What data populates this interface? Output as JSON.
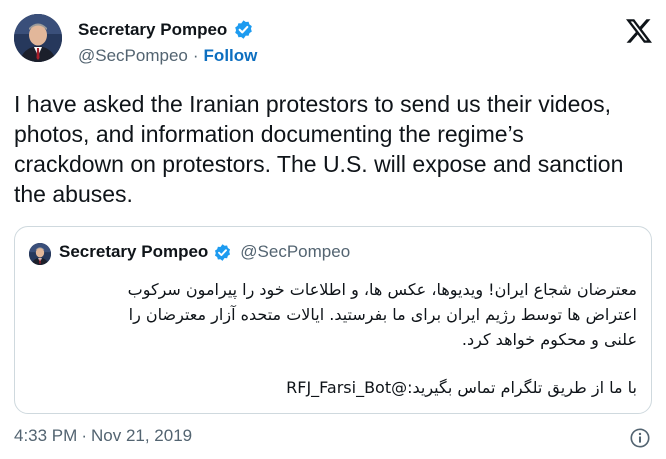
{
  "tweet": {
    "author": {
      "display_name": "Secretary Pompeo",
      "handle": "@SecPompeo",
      "follow_label": "Follow",
      "separator": "·",
      "verified_icon": "verified-badge-icon",
      "avatar": "profile-photo"
    },
    "brand_icon": "x-logo-icon",
    "text": "I have asked the Iranian protestors to send us their videos, photos, and information documenting the regime’s crackdown on protestors. The U.S. will expose and sanction the abuses.",
    "quote": {
      "display_name": "Secretary Pompeo",
      "handle": "@SecPompeo",
      "lines": [
        "معترضان شجاع ایران! ویدیوها، عکس ها، و اطلاعات خود را پیرامون سرکوب",
        "اعتراض ها توسط رژیم ایران برای ما بفرستید. ایالات متحده آزار معترضان را",
        "علنی و محکوم خواهد کرد."
      ],
      "contact_line": "با ما از طریق تلگرام تماس بگیرید:@RFJ_Farsi_Bot"
    },
    "time": "4:33 PM",
    "date": "Nov 21, 2019",
    "info_icon": "info-icon"
  },
  "colors": {
    "text": "#0f1419",
    "secondary": "#536471",
    "verified": "#1d9bf0",
    "follow": "#0d6fc0",
    "border": "#cfd9de"
  }
}
